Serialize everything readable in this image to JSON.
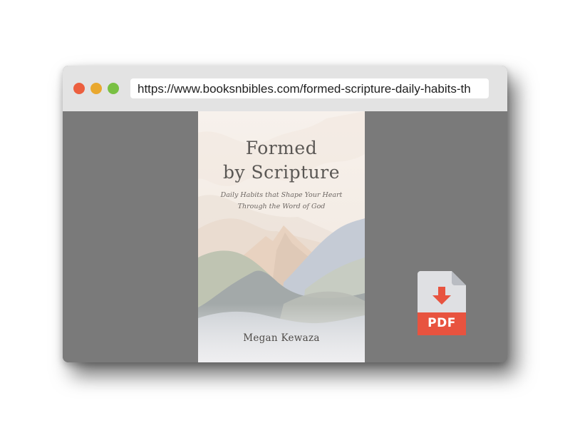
{
  "browser": {
    "url": "https://www.booksnbibles.com/formed-scripture-daily-habits-th"
  },
  "book": {
    "title_line1": "Formed",
    "title_line2": "by Scripture",
    "subtitle_line1": "Daily Habits that Shape Your Heart",
    "subtitle_line2": "Through the Word of God",
    "author": "Megan Kewaza"
  },
  "download": {
    "label": "PDF",
    "icon": "pdf-download-icon"
  },
  "colors": {
    "window_background": "#7a7a7a",
    "titlebar": "#e3e3e3",
    "close_dot": "#ec5f3f",
    "minimize_dot": "#e9a82f",
    "maximize_dot": "#79c043",
    "pdf_red": "#e8533f",
    "pdf_file": "#dfe0e3"
  }
}
